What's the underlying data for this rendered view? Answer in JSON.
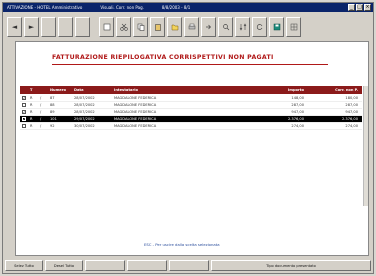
{
  "window": {
    "title_segments": [
      "ATTIVAZIONE - HOTEL Amministrativo",
      "Visuali. Corr. non Pag.",
      "8/8/2003 - 8/1"
    ]
  },
  "toolbar": {
    "buttons": [
      "◄",
      "►",
      "",
      "",
      "",
      "",
      "",
      "",
      "",
      "",
      "",
      "",
      "",
      "",
      "",
      "",
      ""
    ]
  },
  "page": {
    "title": "FATTURAZIONE RIEPILOGATIVA CORRISPETTIVI NON PAGATI",
    "note": "ESC - Per uscire dalla scelta selezionata"
  },
  "table": {
    "columns": [
      "",
      "T",
      "Numero",
      "Data",
      "Intestatario",
      "Importo",
      "Corr. non P."
    ],
    "rows": [
      {
        "check": "✓",
        "t": "R",
        "slash": "/",
        "numero": "87",
        "data": "28/07/2002",
        "intestatario": "MAGDALONE FEDERICA",
        "importo": "148,00",
        "corr": "180,00",
        "selected": false
      },
      {
        "check": "",
        "t": "R",
        "slash": "/",
        "numero": "88",
        "data": "28/07/2002",
        "intestatario": "MAGDALONE FEDERICA",
        "importo": "287,00",
        "corr": "287,00",
        "selected": false
      },
      {
        "check": "✓",
        "t": "R",
        "slash": "/",
        "numero": "89",
        "data": "28/07/2002",
        "intestatario": "MAGDALONE FEDERICA",
        "importo": "947,00",
        "corr": "947,00",
        "selected": false
      },
      {
        "check": "✓",
        "t": "R",
        "slash": "/",
        "numero": "101",
        "data": "29/07/2002",
        "intestatario": "MAGDALONE FEDERICA",
        "importo": "2.376,00",
        "corr": "2.376,00",
        "selected": true
      },
      {
        "check": "",
        "t": "R",
        "slash": "/",
        "numero": "92",
        "data": "30/07/2002",
        "intestatario": "MAGDALONE FEDERICA",
        "importo": "274,00",
        "corr": "274,00",
        "selected": false
      }
    ]
  },
  "footer": {
    "buttons": [
      "Selez Tutto",
      "Desel Tutto",
      "",
      "",
      "",
      "Tipo documento presentato"
    ]
  }
}
